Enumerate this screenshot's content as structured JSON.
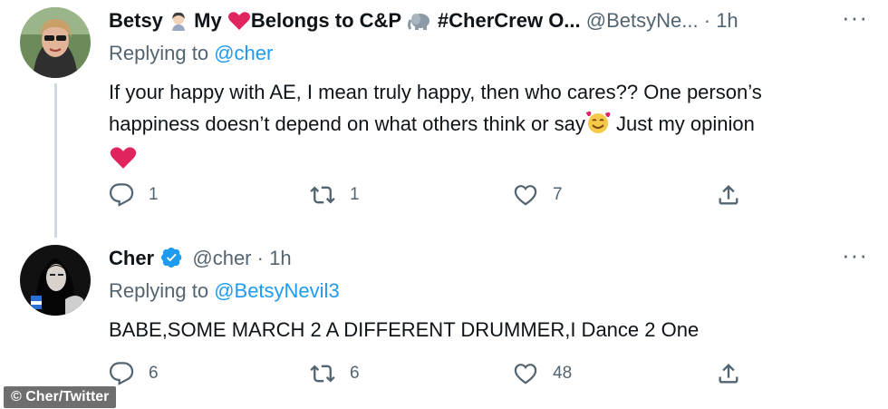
{
  "tweets": [
    {
      "name_parts": [
        "Betsy",
        " My",
        "Belongs to C&P",
        " #CherCrew O..."
      ],
      "handle": "@BetsyNe...",
      "dot": "·",
      "time": "1h",
      "more": "···",
      "replying_prefix": "Replying to ",
      "replying_to": "@cher",
      "body_text": "If your happy with AE, I mean truly happy, then who cares?? One person’s happiness doesn’t depend on what others think or say",
      "body_suffix": " Just my opinion",
      "replies": "1",
      "retweets": "1",
      "likes": "7"
    },
    {
      "name": "Cher",
      "handle": "@cher",
      "dot": "·",
      "time": "1h",
      "more": "···",
      "replying_prefix": "Replying to ",
      "replying_to": "@BetsyNevil3",
      "body_text": "BABE,SOME MARCH 2 A DIFFERENT DRUMMER,I Dance 2 One",
      "replies": "6",
      "retweets": "6",
      "likes": "48"
    }
  ],
  "credit": "© Cher/Twitter",
  "colors": {
    "accent": "#1d9bf0",
    "muted": "#536471",
    "text": "#0f1419",
    "heart": "#e0245e"
  },
  "icons": [
    "reply-icon",
    "retweet-icon",
    "like-icon",
    "share-icon",
    "verified-badge-icon",
    "heart-emoji",
    "elephant-emoji",
    "smiling-hearts-emoji",
    "woman-emoji"
  ]
}
